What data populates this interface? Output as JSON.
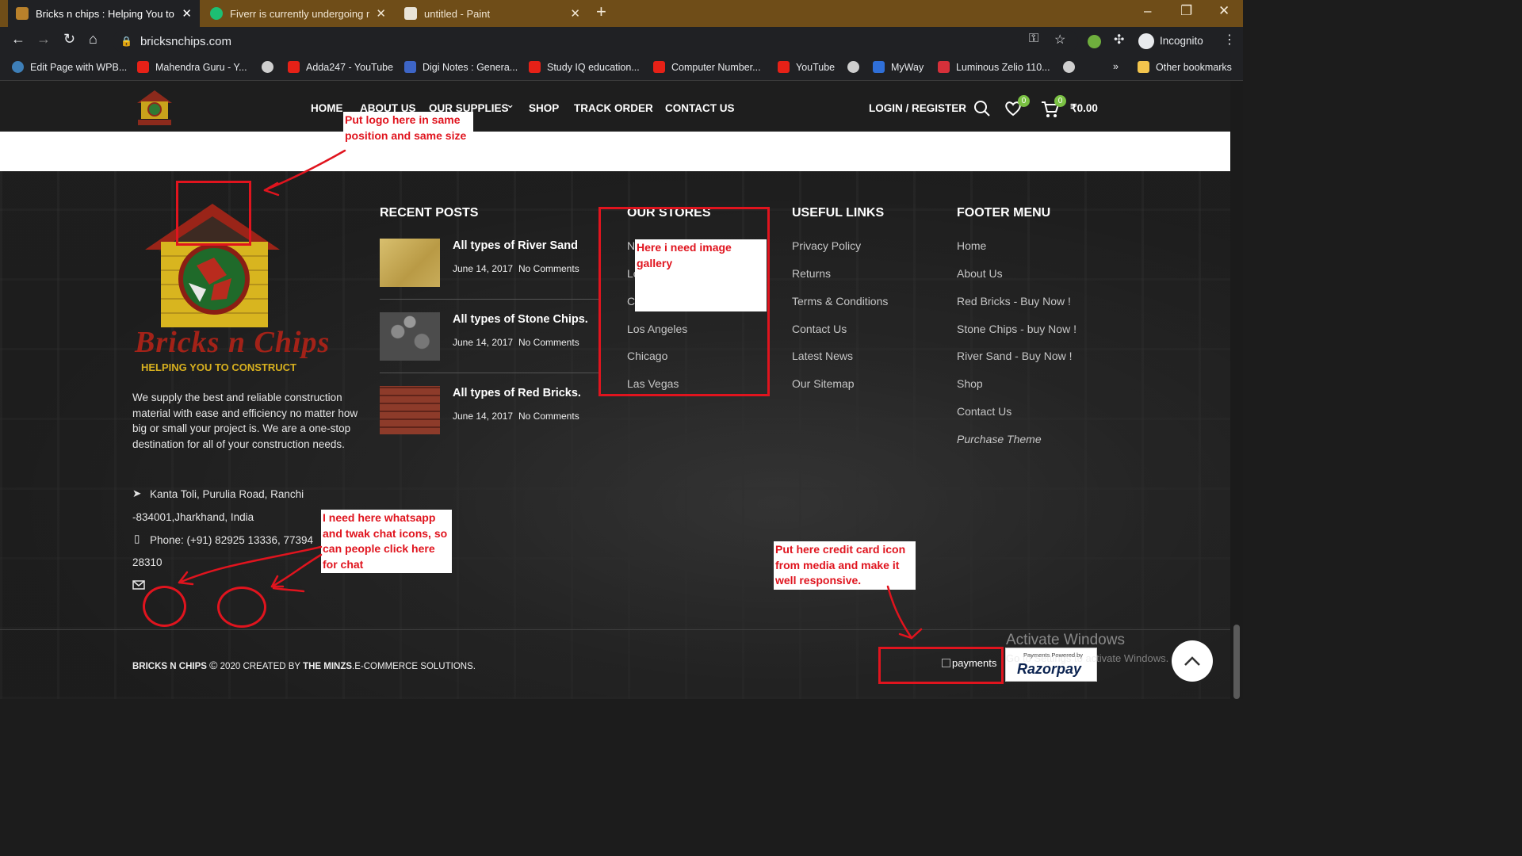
{
  "browser": {
    "tabs": [
      {
        "title": "Bricks n chips : Helping You to Co",
        "close": "✕",
        "active": true
      },
      {
        "title": "Fiverr is currently undergoing ma",
        "close": "✕",
        "active": false
      },
      {
        "title": "untitled - Paint",
        "close": "✕",
        "active": false
      }
    ],
    "new_tab": "+",
    "window_controls": [
      "–",
      "❐",
      "✕"
    ],
    "url": "bricksnchips.com",
    "profile_label": "Incognito",
    "bookmarks": [
      "Edit Page with WPB...",
      "Mahendra Guru - Y...",
      "Adda247 - YouTube",
      "Digi Notes : Genera...",
      "Study IQ education...",
      "Computer Number...",
      "YouTube",
      "MyWay",
      "Luminous Zelio 110..."
    ],
    "bookmarks_overflow": "»",
    "other_bookmarks": "Other bookmarks"
  },
  "site_header": {
    "menu": [
      "HOME",
      "ABOUT US",
      "OUR SUPPLIES",
      "SHOP",
      "TRACK ORDER",
      "CONTACT US"
    ],
    "supplies_caret": "⌄",
    "login": "LOGIN / REGISTER",
    "wishlist_count": "0",
    "cart_count": "0",
    "cart_total": "₹0.00"
  },
  "footer": {
    "logo": {
      "brand_text": "Bricks n Chips",
      "tagline": "HELPING YOU TO CONSTRUCT"
    },
    "about": "We supply the best and reliable construction material with ease and efficiency no matter how big or small your project is. We are a one-stop destination for all of your construction needs.",
    "address_1": "Kanta Toli, Purulia Road, Ranchi",
    "address_2": "-834001,Jharkhand, India",
    "phone_1": "Phone: (+91) 82925 13336, 77394",
    "phone_2": "28310",
    "recent_posts": {
      "heading": "RECENT POSTS",
      "posts": [
        {
          "title": "All types of River Sand",
          "date": "June 14, 2017",
          "comments": "No Comments"
        },
        {
          "title": "All types of Stone Chips.",
          "date": "June 14, 2017",
          "comments": "No Comments"
        },
        {
          "title": "All types of Red Bricks.",
          "date": "June 14, 2017",
          "comments": "No Comments"
        }
      ]
    },
    "our_stores": {
      "heading": "OUR STORES",
      "stores_partial": [
        "N",
        "Lo",
        "C"
      ],
      "stores": [
        "Los Angeles",
        "Chicago",
        "Las Vegas"
      ]
    },
    "useful_links": {
      "heading": "USEFUL LINKS",
      "links": [
        "Privacy Policy",
        "Returns",
        "Terms & Conditions",
        "Contact Us",
        "Latest News",
        "Our Sitemap"
      ]
    },
    "footer_menu": {
      "heading": "FOOTER MENU",
      "links": [
        "Home",
        "About Us",
        "Red Bricks - Buy Now !",
        "Stone Chips - buy Now !",
        "River Sand - Buy Now !",
        "Shop",
        "Contact Us"
      ],
      "purchase": "Purchase Theme"
    },
    "copyright": {
      "brand": "BRICKS N CHIPS",
      "symbol": "©",
      "text": " 2020 CREATED BY ",
      "company": "THE MINZS",
      "suffix": ".E-COMMERCE SOLUTIONS."
    },
    "payments_alt": "payments",
    "razorpay": {
      "small": "Payments Powered by",
      "brand": "Razorpay"
    }
  },
  "annotations": {
    "logo_note": "Put logo here in same position and same size",
    "gallery_note": "Here i need image gallery",
    "chat_note": "I need here whatsapp and twak chat icons, so can people click here for chat",
    "card_note": "Put here credit card icon from media and make it well responsive."
  },
  "os_watermark": {
    "title": "Activate Windows",
    "subtitle": "Go to Settings to activate Windows."
  },
  "colors": {
    "annotation_red": "#e0141e",
    "tab_strip": "#6f4d18",
    "header_bg": "#1e1e1e"
  }
}
